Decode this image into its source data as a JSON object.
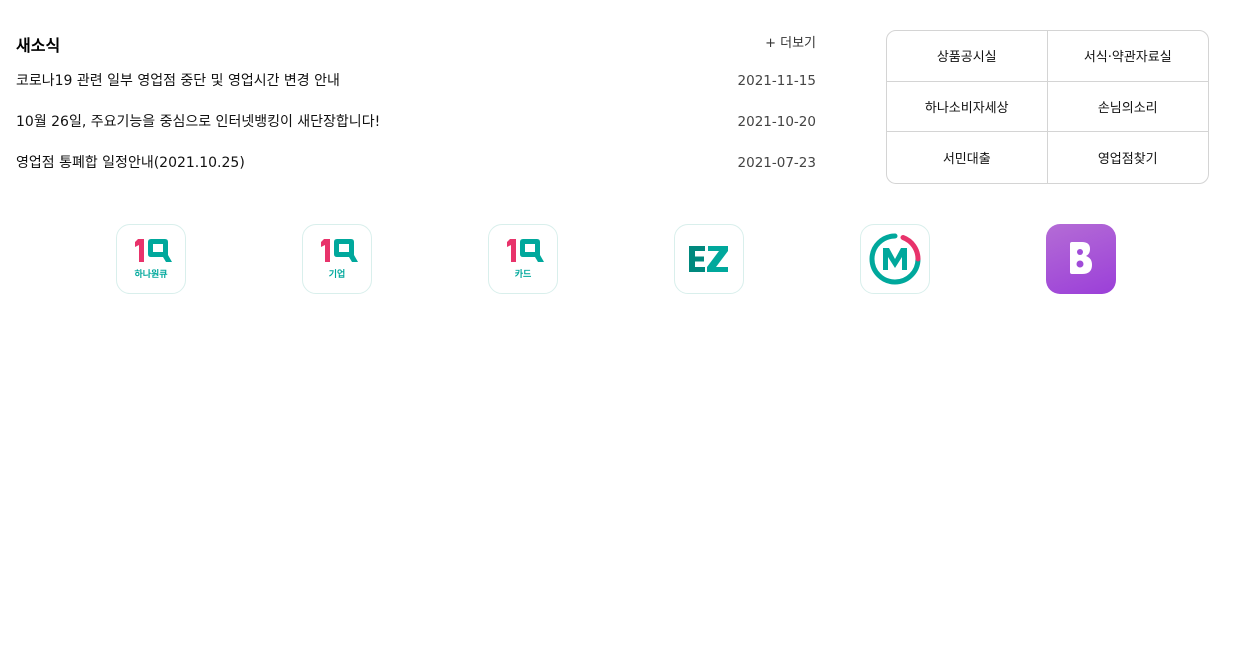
{
  "news": {
    "title": "새소식",
    "more_label": "+ 더보기",
    "items": [
      {
        "title": "코로나19 관련 일부 영업점 중단 및 영업시간 변경 안내",
        "date": "2021-11-15"
      },
      {
        "title": "10월 26일, 주요기능을 중심으로 인터넷뱅킹이 새단장합니다!",
        "date": "2021-10-20"
      },
      {
        "title": "영업점 통폐합 일정안내(2021.10.25)",
        "date": "2021-07-23"
      }
    ]
  },
  "quick_links": [
    "상품공시실",
    "서식·약관자료실",
    "하나소비자세상",
    "손님의소리",
    "서민대출",
    "영업점찾기"
  ],
  "apps": [
    {
      "icon": "1q-hana-won-icon",
      "caption": "하나원큐"
    },
    {
      "icon": "1q-business-icon",
      "caption": "기업"
    },
    {
      "icon": "1q-card-icon",
      "caption": "카드"
    },
    {
      "icon": "ez-icon"
    },
    {
      "icon": "m-icon"
    },
    {
      "icon": "b-icon"
    }
  ],
  "colors": {
    "brand_pink": "#e8336b",
    "brand_teal": "#00a89c",
    "app_purple": "#9b3fd8"
  }
}
